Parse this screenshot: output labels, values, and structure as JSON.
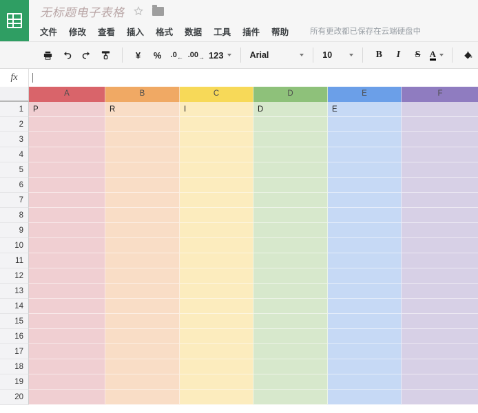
{
  "app": {
    "logo_icon": "sheets-grid-icon",
    "brand_color": "#2f9e63"
  },
  "header": {
    "doc_title": "无标题电子表格",
    "star_icon": "star-outline-icon",
    "folder_icon": "folder-icon",
    "menu_items": [
      "文件",
      "修改",
      "查看",
      "插入",
      "格式",
      "数据",
      "工具",
      "插件",
      "帮助"
    ],
    "save_status": "所有更改都已保存在云端硬盘中"
  },
  "toolbar": {
    "print_icon": "print-icon",
    "undo_icon": "undo-icon",
    "redo_icon": "redo-icon",
    "paint_format_icon": "paint-format-icon",
    "currency_label": "¥",
    "percent_label": "%",
    "decrease_decimal_label": ".0",
    "increase_decimal_label": ".00",
    "number_format_label": "123",
    "font_name": "Arial",
    "font_size": "10",
    "bold_label": "B",
    "italic_label": "I",
    "strikethrough_label": "S",
    "text_color_label": "A",
    "fill_color_icon": "paint-bucket-icon"
  },
  "formula_bar": {
    "fx_label": "fx",
    "value": "",
    "placeholder": ""
  },
  "grid": {
    "columns": [
      {
        "label": "A",
        "header_color": "#d9646a",
        "cell_color": "#f0cfd2"
      },
      {
        "label": "B",
        "header_color": "#f0a964",
        "cell_color": "#f9ddc6"
      },
      {
        "label": "C",
        "header_color": "#f7d958",
        "cell_color": "#fcecbe"
      },
      {
        "label": "D",
        "header_color": "#8ec17a",
        "cell_color": "#d7e8cc"
      },
      {
        "label": "E",
        "header_color": "#6b9fe8",
        "cell_color": "#c6d9f5"
      },
      {
        "label": "F",
        "header_color": "#8f7cc0",
        "cell_color": "#d7d0e6"
      }
    ],
    "rows": [
      {
        "number": "1",
        "cells": [
          "P",
          "R",
          "I",
          "D",
          "E",
          ""
        ]
      },
      {
        "number": "2",
        "cells": [
          "",
          "",
          "",
          "",
          "",
          ""
        ]
      },
      {
        "number": "3",
        "cells": [
          "",
          "",
          "",
          "",
          "",
          ""
        ]
      },
      {
        "number": "4",
        "cells": [
          "",
          "",
          "",
          "",
          "",
          ""
        ]
      },
      {
        "number": "5",
        "cells": [
          "",
          "",
          "",
          "",
          "",
          ""
        ]
      },
      {
        "number": "6",
        "cells": [
          "",
          "",
          "",
          "",
          "",
          ""
        ]
      },
      {
        "number": "7",
        "cells": [
          "",
          "",
          "",
          "",
          "",
          ""
        ]
      },
      {
        "number": "8",
        "cells": [
          "",
          "",
          "",
          "",
          "",
          ""
        ]
      },
      {
        "number": "9",
        "cells": [
          "",
          "",
          "",
          "",
          "",
          ""
        ]
      },
      {
        "number": "10",
        "cells": [
          "",
          "",
          "",
          "",
          "",
          ""
        ]
      },
      {
        "number": "11",
        "cells": [
          "",
          "",
          "",
          "",
          "",
          ""
        ]
      },
      {
        "number": "12",
        "cells": [
          "",
          "",
          "",
          "",
          "",
          ""
        ]
      },
      {
        "number": "13",
        "cells": [
          "",
          "",
          "",
          "",
          "",
          ""
        ]
      },
      {
        "number": "14",
        "cells": [
          "",
          "",
          "",
          "",
          "",
          ""
        ]
      },
      {
        "number": "15",
        "cells": [
          "",
          "",
          "",
          "",
          "",
          ""
        ]
      },
      {
        "number": "16",
        "cells": [
          "",
          "",
          "",
          "",
          "",
          ""
        ]
      },
      {
        "number": "17",
        "cells": [
          "",
          "",
          "",
          "",
          "",
          ""
        ]
      },
      {
        "number": "18",
        "cells": [
          "",
          "",
          "",
          "",
          "",
          ""
        ]
      },
      {
        "number": "19",
        "cells": [
          "",
          "",
          "",
          "",
          "",
          ""
        ]
      },
      {
        "number": "20",
        "cells": [
          "",
          "",
          "",
          "",
          "",
          ""
        ]
      }
    ]
  }
}
